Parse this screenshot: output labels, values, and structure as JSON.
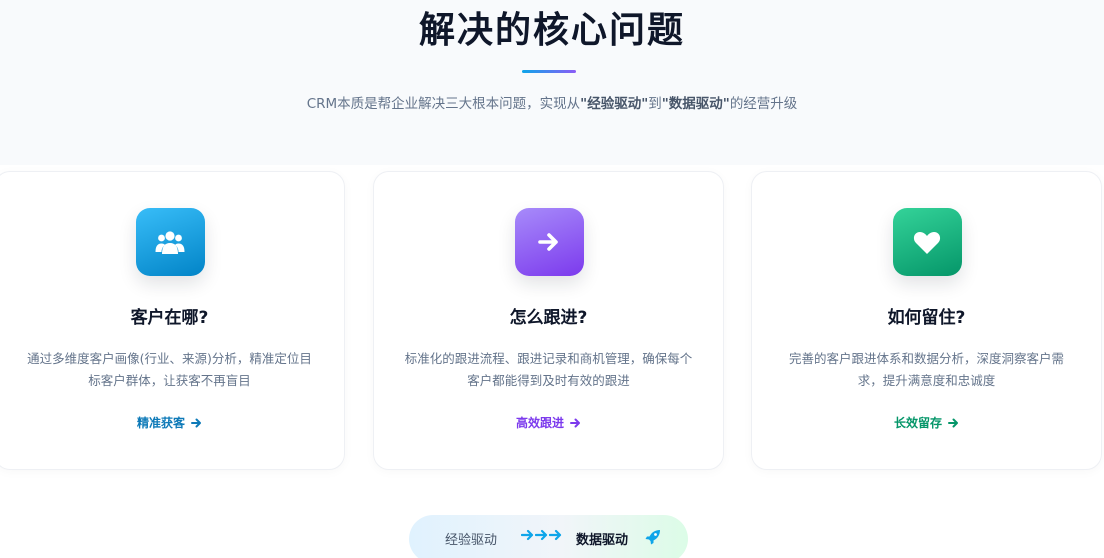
{
  "header": {
    "title": "解决的核心问题",
    "subtitle_prefix": "CRM本质是帮企业解决三大根本问题，实现从",
    "subtitle_from": "\"经验驱动\"",
    "subtitle_mid": "到",
    "subtitle_to": "\"数据驱动\"",
    "subtitle_suffix": "的经营升级"
  },
  "cards": [
    {
      "icon": "users-icon",
      "title": "客户在哪?",
      "description": "通过多维度客户画像(行业、来源)分析，精准定位目标客户群体，让获客不再盲目",
      "link": "精准获客",
      "accent": "#0e7ab8"
    },
    {
      "icon": "arrow-right-icon",
      "title": "怎么跟进?",
      "description": "标准化的跟进流程、跟进记录和商机管理，确保每个客户都能得到及时有效的跟进",
      "link": "高效跟进",
      "accent": "#7c3aed"
    },
    {
      "icon": "heart-icon",
      "title": "如何留住?",
      "description": "完善的客户跟进体系和数据分析，深度洞察客户需求，提升满意度和忠诚度",
      "link": "长效留存",
      "accent": "#059669"
    }
  ],
  "transition": {
    "from": "经验驱动",
    "to": "数据驱动",
    "icon": "rocket-icon"
  }
}
